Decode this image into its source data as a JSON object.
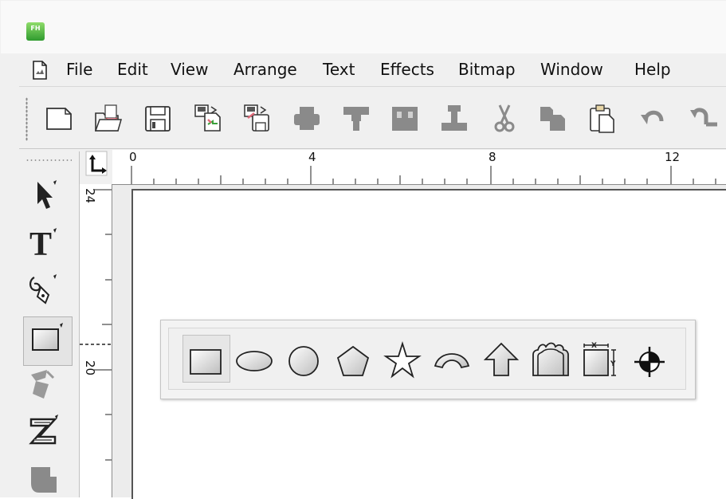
{
  "app": {
    "icon_text": "FH"
  },
  "menubar": {
    "items": [
      {
        "label": "File"
      },
      {
        "label": "Edit"
      },
      {
        "label": "View"
      },
      {
        "label": "Arrange"
      },
      {
        "label": "Text"
      },
      {
        "label": "Effects"
      },
      {
        "label": "Bitmap"
      },
      {
        "label": "Window"
      },
      {
        "label": "Help"
      }
    ]
  },
  "toolbar": {
    "icons": [
      "new-document-icon",
      "open-icon",
      "save-icon",
      "import-icon",
      "export-icon",
      "print-icon",
      "align-icon",
      "group-icon",
      "ungroup-icon",
      "cut-icon",
      "copy-icon",
      "paste-icon",
      "undo-icon",
      "redo-icon"
    ]
  },
  "toolbox": {
    "tools": [
      "pointer-icon",
      "text-tool-icon",
      "pen-tool-icon",
      "rectangle-tool-icon",
      "fill-tool-icon",
      "zoom-tool-icon",
      "hand-tool-icon"
    ]
  },
  "rulers": {
    "horizontal": [
      "0",
      "4",
      "8",
      "12"
    ],
    "vertical": [
      "24",
      "20"
    ]
  },
  "shapes_popup": {
    "shapes": [
      "rectangle-shape-icon",
      "ellipse-shape-icon",
      "circle-shape-icon",
      "pentagon-shape-icon",
      "star-shape-icon",
      "arc-shape-icon",
      "arrow-shape-icon",
      "rounded-frame-shape-icon",
      "dimension-shape-icon",
      "crosshair-shape-icon"
    ]
  },
  "colors": {
    "accent": "#2f9b2f",
    "icon_gray": "#7a7a7a"
  }
}
